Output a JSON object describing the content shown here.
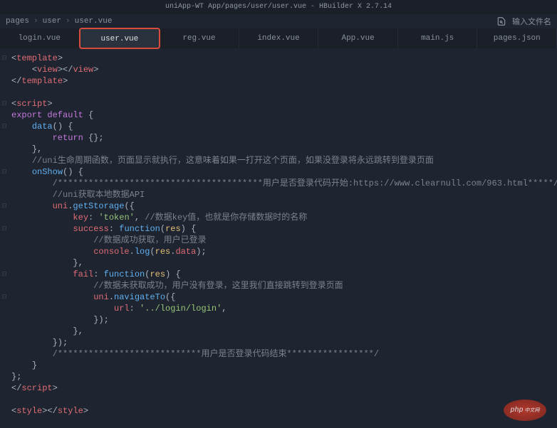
{
  "titlebar": {
    "title": "uniApp-WT App/pages/user/user.vue - HBuilder X 2.7.14"
  },
  "breadcrumbs": {
    "item1": "pages",
    "item2": "user",
    "item3": "user.vue"
  },
  "search": {
    "placeholder": "输入文件名"
  },
  "tabs": {
    "t0": "login.vue",
    "t1": "user.vue",
    "t2": "reg.vue",
    "t3": "index.vue",
    "t4": "App.vue",
    "t5": "main.js",
    "t6": "pages.json"
  },
  "code": {
    "l1_open": "<",
    "l1_tag": "template",
    "l1_close": ">",
    "l2_indent": "    ",
    "l2_vopen": "<",
    "l2_vtag": "view",
    "l2_vclose": "></",
    "l2_vtag2": "view",
    "l2_vend": ">",
    "l3_open": "</",
    "l3_tag": "template",
    "l3_close": ">",
    "l5_open": "<",
    "l5_tag": "script",
    "l5_close": ">",
    "l6_export": "export default",
    "l6_brace": " {",
    "l7_indent": "    ",
    "l7_data": "data",
    "l7_paren": "() {",
    "l8_indent": "        ",
    "l8_return": "return",
    "l8_obj": " {};",
    "l9_indent": "    ",
    "l9_close": "},",
    "l10_indent": "    ",
    "l10_comment": "//uni生命周期函数，页面显示就执行，这意味着如果一打开这个页面，如果没登录将永远跳转到登录页面",
    "l11_indent": "    ",
    "l11_onshow": "onShow",
    "l11_paren": "() {",
    "l12_indent": "        ",
    "l12_comment": "/****************************************用户是否登录代码开始:https://www.clearnull.com/963.html*****/",
    "l13_indent": "        ",
    "l13_comment": "//uni获取本地数据API",
    "l14_indent": "        ",
    "l14_uni": "uni",
    "l14_dot": ".",
    "l14_method": "getStorage",
    "l14_open": "({",
    "l15_indent": "            ",
    "l15_key": "key",
    "l15_colon": ": ",
    "l15_val": "'token'",
    "l15_comma": ", ",
    "l15_comment": "//数据key值，也就是你存储数据时的名称",
    "l16_indent": "            ",
    "l16_success": "success",
    "l16_colon": ": ",
    "l16_func": "function",
    "l16_paren": "(",
    "l16_res": "res",
    "l16_close": ") {",
    "l17_indent": "                ",
    "l17_comment": "//数据成功获取，用户已登录",
    "l18_indent": "                ",
    "l18_console": "console",
    "l18_dot": ".",
    "l18_log": "log",
    "l18_open": "(",
    "l18_res": "res",
    "l18_dot2": ".",
    "l18_data": "data",
    "l18_close": ");",
    "l19_indent": "            ",
    "l19_close": "},",
    "l20_indent": "            ",
    "l20_fail": "fail",
    "l20_colon": ": ",
    "l20_func": "function",
    "l20_paren": "(",
    "l20_res": "res",
    "l20_close": ") {",
    "l21_indent": "                ",
    "l21_comment": "//数据未获取成功，用户没有登录，这里我们直接跳转到登录页面",
    "l22_indent": "                ",
    "l22_uni": "uni",
    "l22_dot": ".",
    "l22_nav": "navigateTo",
    "l22_open": "({",
    "l23_indent": "                    ",
    "l23_url": "url",
    "l23_colon": ": ",
    "l23_val": "'../login/login'",
    "l23_comma": ",",
    "l24_indent": "                ",
    "l24_close": "});",
    "l25_indent": "            ",
    "l25_close": "},",
    "l26_indent": "        ",
    "l26_close": "});",
    "l27_indent": "        ",
    "l27_comment": "/****************************用户是否登录代码结束*****************/",
    "l28_indent": "    ",
    "l28_close": "}",
    "l29_close": "};",
    "l30_open": "</",
    "l30_tag": "script",
    "l30_close": ">",
    "l32_open": "<",
    "l32_tag": "style",
    "l32_mid": "></",
    "l32_tag2": "style",
    "l32_end": ">"
  },
  "watermark": {
    "text": "php",
    "sub": "中文网"
  }
}
